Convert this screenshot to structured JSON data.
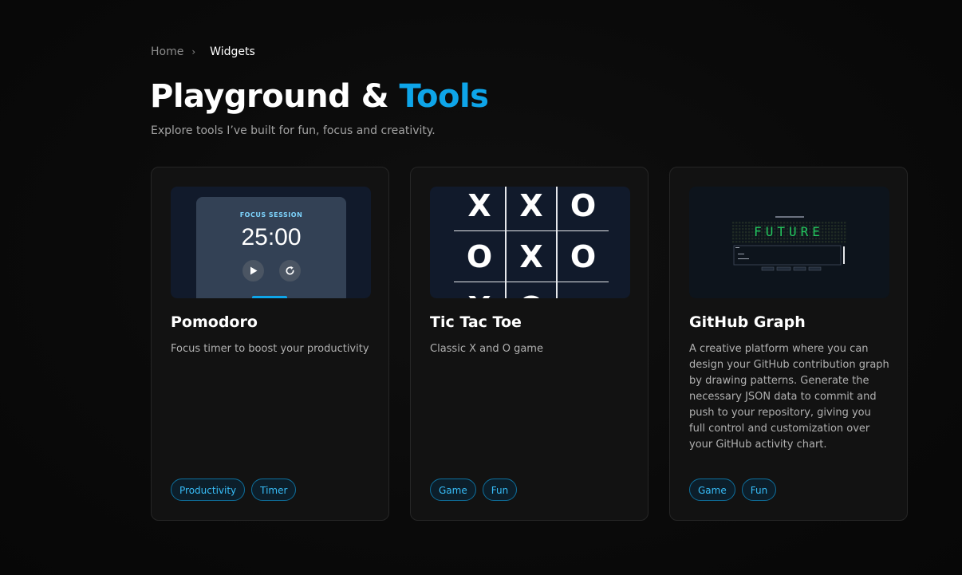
{
  "breadcrumb": {
    "home": "Home",
    "separator": "›",
    "current": "Widgets"
  },
  "header": {
    "title_main": "Playground & ",
    "title_accent": "Tools",
    "subtitle": "Explore tools I’ve built for fun, focus and creativity.",
    "accent_color": "#0ea5e9"
  },
  "cards": [
    {
      "title": "Pomodoro",
      "description": "Focus timer to boost your productivity",
      "tags": [
        "Productivity",
        "Timer"
      ],
      "preview": {
        "label": "FOCUS SESSION",
        "time": "25:00",
        "play_icon": "play-icon",
        "reset_icon": "reset-icon"
      }
    },
    {
      "title": "Tic Tac Toe",
      "description": "Classic X and O game",
      "tags": [
        "Game",
        "Fun"
      ],
      "preview": {
        "board": [
          "X",
          "X",
          "O",
          "O",
          "X",
          "O",
          "X",
          "O",
          ""
        ]
      }
    },
    {
      "title": "GitHub Graph",
      "description": "A creative platform where you can design your GitHub contribution graph by drawing patterns. Generate the necessary JSON data to commit and push to your repository, giving you full control and customization over your GitHub activity chart.",
      "tags": [
        "Game",
        "Fun"
      ],
      "preview": {
        "pattern_text": "FUTURE"
      }
    }
  ]
}
